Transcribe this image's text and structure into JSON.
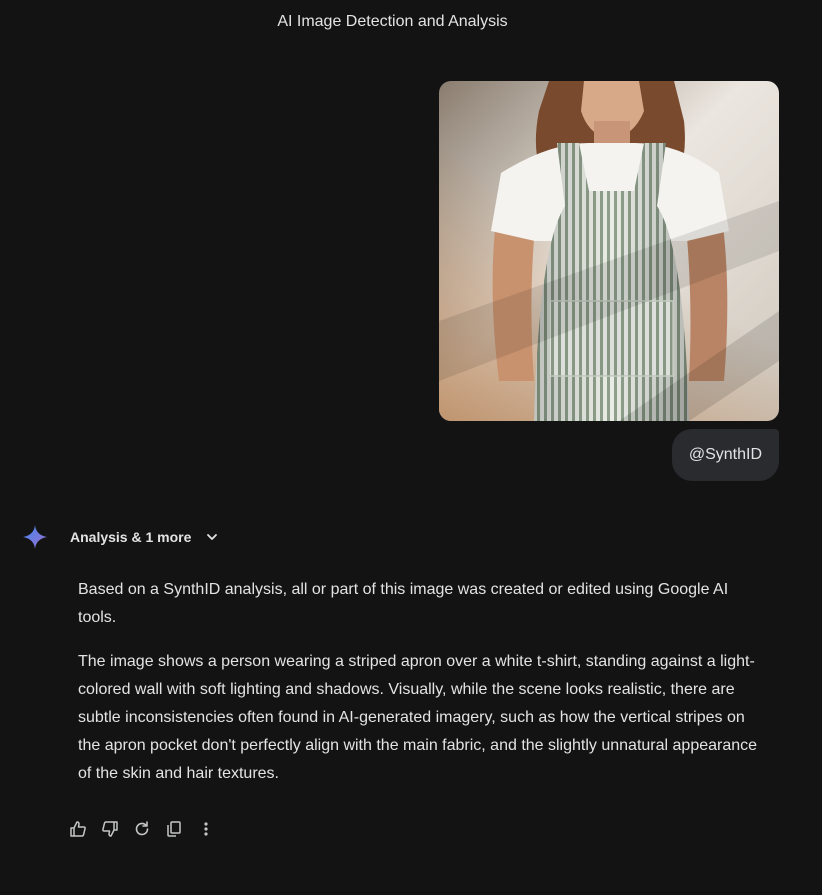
{
  "conversation": {
    "title": "AI Image Detection and Analysis"
  },
  "user_message": {
    "image_description_icon": "uploaded-photo",
    "mention_text": "@SynthID"
  },
  "response": {
    "tools_label": "Analysis & 1 more",
    "paragraphs": [
      "Based on a SynthID analysis, all or part of this image was created or edited using Google AI tools.",
      "The image shows a person wearing a striped apron over a white t-shirt, standing against a light-colored wall with soft lighting and shadows. Visually, while the scene looks realistic, there are subtle inconsistencies often found in AI-generated imagery, such as how the vertical stripes on the apron pocket don't perfectly align with the main fabric, and the slightly unnatural appearance of the skin and hair textures."
    ]
  },
  "actions": [
    {
      "name": "thumbs-up-icon"
    },
    {
      "name": "thumbs-down-icon"
    },
    {
      "name": "regenerate-icon"
    },
    {
      "name": "copy-icon"
    },
    {
      "name": "more-options-icon"
    }
  ],
  "colors": {
    "background": "#131314",
    "text": "#e3e3e3",
    "chip": "#2a2b2e",
    "gem_start": "#4285f4",
    "gem_end": "#9b72cb"
  }
}
